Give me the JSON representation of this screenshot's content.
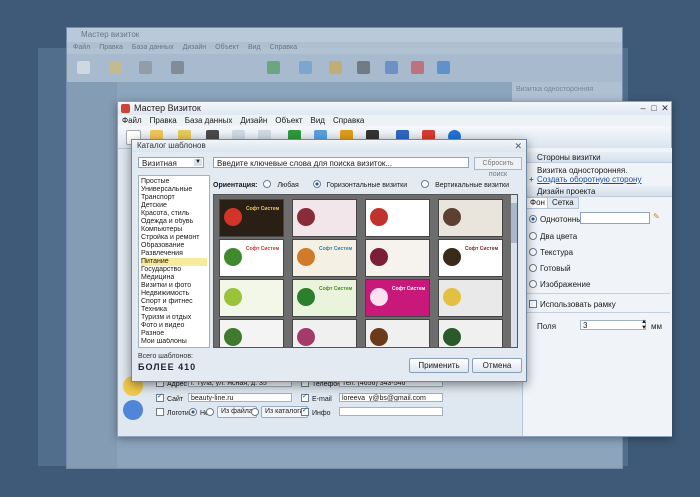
{
  "ghost": {
    "title": "Мастер визиток",
    "menu": [
      "Файл",
      "Правка",
      "База данных",
      "Дизайн",
      "Объект",
      "Вид",
      "Справка"
    ],
    "right_note": "Визитка односторонняя"
  },
  "window": {
    "title": "Мастер Визиток",
    "menu": [
      "Файл",
      "Правка",
      "База данных",
      "Дизайн",
      "Объект",
      "Вид",
      "Справка"
    ]
  },
  "right_panel": {
    "section_sides": "Стороны визитки",
    "one_sided": "Визитка односторонняя.",
    "create_back": "Создать оборотную сторону",
    "section_design": "Дизайн проекта",
    "tabs": [
      "Фон",
      "Сетка"
    ],
    "bg_options": [
      "Однотонный",
      "Два цвета",
      "Текстура",
      "Готовый",
      "Изображение"
    ],
    "use_frame": "Использовать рамку",
    "margins_label": "Поля",
    "margins_value": "3",
    "margins_unit": "мм"
  },
  "contact": {
    "address_label": "Адрес",
    "address_value": "г. Тула, ул. Ясная, д. 35",
    "phone2_label": "Телефон 2",
    "phone2_value": "Тел. (4656) 343-546",
    "site_label": "Сайт",
    "site_value": "beauty-line.ru",
    "email_label": "E-mail",
    "email_value": "loreeva_y@bs@gmail.com",
    "logo_label": "Логотип",
    "logo_none": "Нет",
    "logo_file": "Из файла",
    "logo_catalog": "Из каталога",
    "info_label": "Инфо"
  },
  "catalog": {
    "title": "Каталог шаблонов",
    "category_select": "Визитная",
    "search_placeholder": "Введите ключевые слова для поиска визиток...",
    "reset_button": "Сбросить поиск",
    "orientation_label": "Ориентация:",
    "orientation_options": [
      "Любая",
      "Горизонтальные визитки",
      "Вертикальные визитки"
    ],
    "categories": [
      "Простые",
      "Универсальные",
      "Транспорт",
      "Детские",
      "Красота, стиль",
      "Одежда и обувь",
      "Компьютеры",
      "Стройка и ремонт",
      "Образование",
      "Развлечения",
      "Питание",
      "Государство",
      "Медицина",
      "Визитки и фото",
      "Недвижимость",
      "Спорт и фитнес",
      "Техника",
      "Туризм и отдых",
      "Фото и видео",
      "Разное",
      "Мои шаблоны"
    ],
    "selected_category": "Питание",
    "count_label": "Всего шаблонов:",
    "count_value": "БОЛЕЕ 410",
    "apply_button": "Применить",
    "cancel_button": "Отмена",
    "cards": [
      {
        "title": "Софт Систем",
        "bg": "#2a1f14",
        "fg": "#e8c766"
      },
      {
        "title": "",
        "bg": "#f3e6ea",
        "fg": "#333"
      },
      {
        "title": "",
        "bg": "#ffffff",
        "fg": "#333"
      },
      {
        "title": "",
        "bg": "#e9e4dc",
        "fg": "#333"
      },
      {
        "title": "Софт Систем",
        "bg": "#ffffff",
        "fg": "#c0392b"
      },
      {
        "title": "Софт Систем",
        "bg": "#f4f1e4",
        "fg": "#2f7fb0"
      },
      {
        "title": "",
        "bg": "#f6f2ee",
        "fg": "#333"
      },
      {
        "title": "Софт Систем",
        "bg": "#ffffff",
        "fg": "#7a2a2a"
      },
      {
        "title": "",
        "bg": "#f2f7e8",
        "fg": "#333"
      },
      {
        "title": "Софт Систем",
        "bg": "#eaf4dd",
        "fg": "#4a8a1a"
      },
      {
        "title": "Софт Систем",
        "bg": "#c8197a",
        "fg": "#ffffff"
      },
      {
        "title": "",
        "bg": "#e9e9e9",
        "fg": "#333"
      },
      {
        "title": "",
        "bg": "#f4f4f4",
        "fg": "#333"
      },
      {
        "title": "",
        "bg": "#f0f0f0",
        "fg": "#333"
      },
      {
        "title": "",
        "bg": "#f0f0f0",
        "fg": "#333"
      },
      {
        "title": "",
        "bg": "#f0f0f0",
        "fg": "#333"
      }
    ]
  }
}
